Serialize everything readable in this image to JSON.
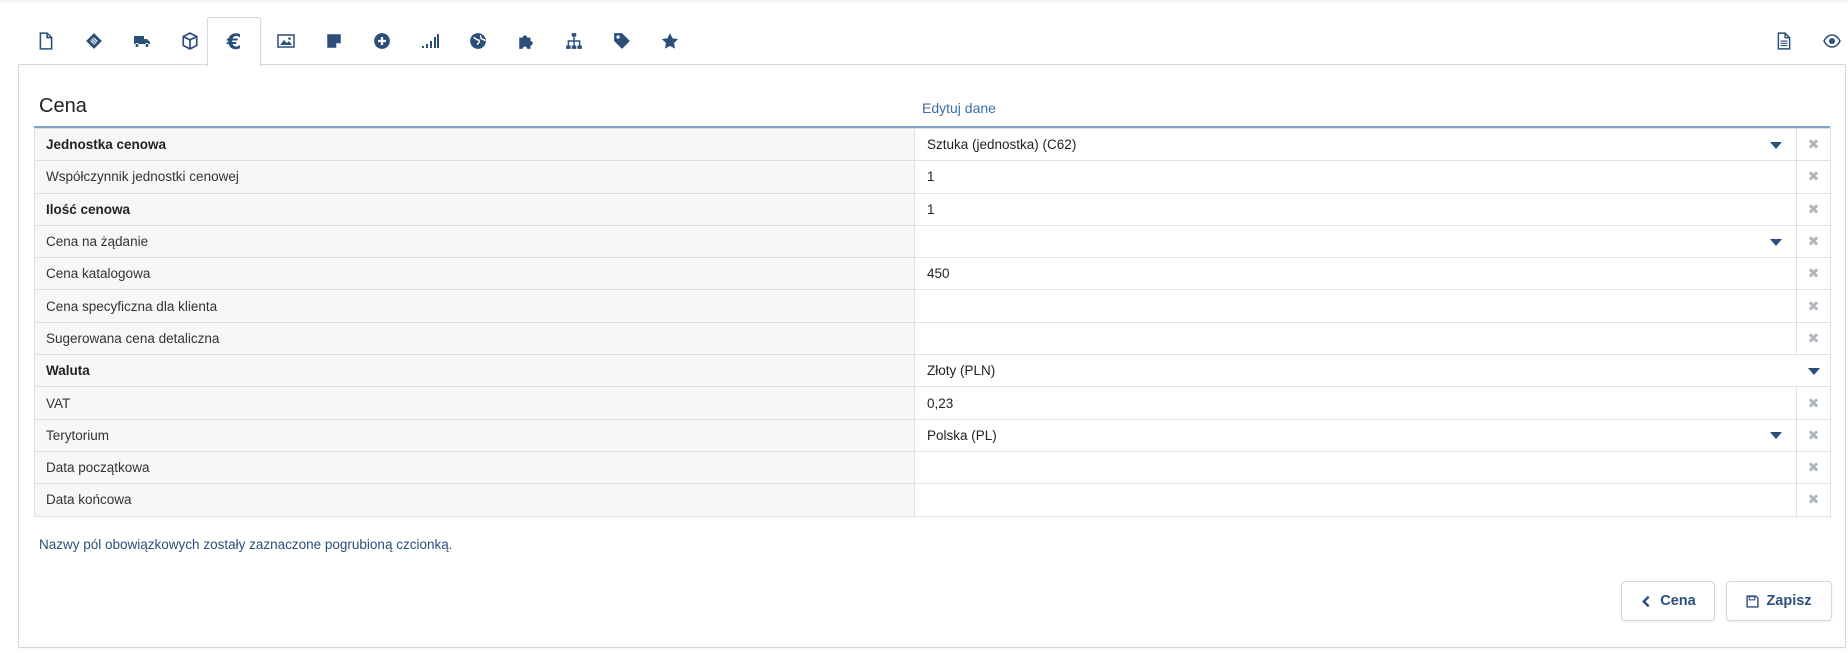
{
  "tabs": [
    {
      "icon": "file-icon"
    },
    {
      "icon": "barcode-tag-icon"
    },
    {
      "icon": "truck-icon"
    },
    {
      "icon": "box-icon"
    },
    {
      "icon": "euro-icon",
      "label": "€",
      "active": true
    },
    {
      "icon": "image-icon"
    },
    {
      "icon": "note-icon"
    },
    {
      "icon": "plus-circle-icon"
    },
    {
      "icon": "signal-bars-icon"
    },
    {
      "icon": "globe-icon"
    },
    {
      "icon": "puzzle-icon"
    },
    {
      "icon": "sitemap-icon"
    },
    {
      "icon": "tag-icon"
    },
    {
      "icon": "star-icon"
    }
  ],
  "right_tabs": [
    {
      "icon": "document-lines-icon"
    },
    {
      "icon": "eye-icon"
    }
  ],
  "panel": {
    "title": "Cena",
    "edit_link": "Edytuj dane"
  },
  "fields": [
    {
      "label": "Jednostka cenowa",
      "value": "Sztuka (jednostka) (C62)",
      "bold": true,
      "dropdown": true,
      "clear": true
    },
    {
      "label": "Współczynnik jednostki cenowej",
      "value": "1",
      "bold": false,
      "dropdown": false,
      "clear": true
    },
    {
      "label": "Ilość cenowa",
      "value": "1",
      "bold": true,
      "dropdown": false,
      "clear": true
    },
    {
      "label": "Cena na żądanie",
      "value": "",
      "bold": false,
      "dropdown": true,
      "clear": true
    },
    {
      "label": "Cena katalogowa",
      "value": "450",
      "bold": false,
      "dropdown": false,
      "clear": true
    },
    {
      "label": "Cena specyficzna dla klienta",
      "value": "",
      "bold": false,
      "dropdown": false,
      "clear": true
    },
    {
      "label": "Sugerowana cena detaliczna",
      "value": "",
      "bold": false,
      "dropdown": false,
      "clear": true
    },
    {
      "label": "Waluta",
      "value": "Złoty (PLN)",
      "bold": true,
      "dropdown": true,
      "clear": false
    },
    {
      "label": "VAT",
      "value": "0,23",
      "bold": false,
      "dropdown": false,
      "clear": true
    },
    {
      "label": "Terytorium",
      "value": "Polska (PL)",
      "bold": false,
      "dropdown": true,
      "clear": true
    },
    {
      "label": "Data początkowa",
      "value": "",
      "bold": false,
      "dropdown": false,
      "clear": true
    },
    {
      "label": "Data końcowa",
      "value": "",
      "bold": false,
      "dropdown": false,
      "clear": true
    }
  ],
  "clear_symbol": "✖",
  "hint": "Nazwy pól obowiązkowych zostały zaznaczone pogrubioną czcionką.",
  "buttons": {
    "back_label": "Cena",
    "save_label": "Zapisz"
  },
  "colors": {
    "accent": "#2b4f7a",
    "link": "#3a6ea5",
    "border": "#d9e1ea"
  }
}
